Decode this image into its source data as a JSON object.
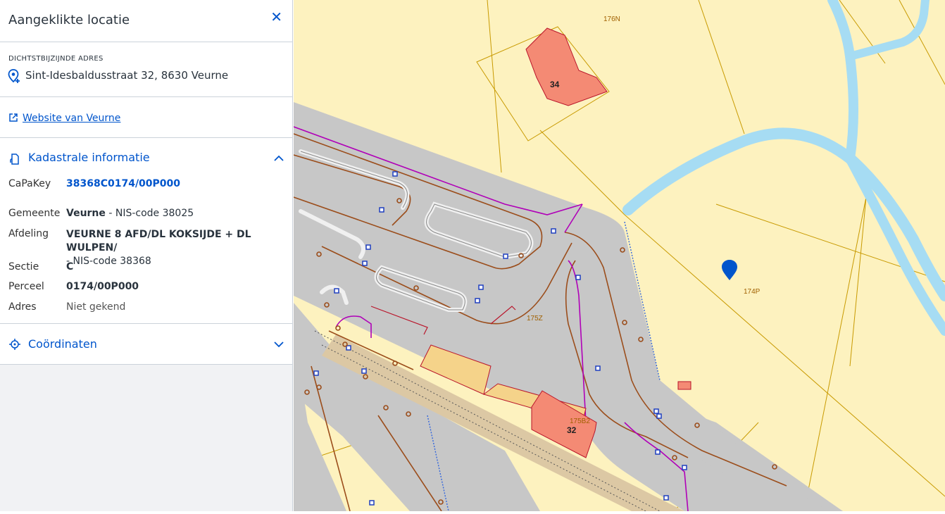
{
  "panel": {
    "title": "Aangeklikte locatie",
    "address_caption": "DICHTSTBIJZIJNDE ADRES",
    "address": "Sint-Idesbaldusstraat 32, 8630 Veurne",
    "website_link": "Website van Veurne",
    "kadaster": {
      "title": "Kadastrale informatie",
      "rows": {
        "capakey_label": "CaPaKey",
        "capakey_value": "38368C0174/00P000",
        "gemeente_label": "Gemeente",
        "gemeente_name": "Veurne",
        "gemeente_suffix": " - NIS-code 38025",
        "afdeling_label": "Afdeling",
        "afdeling_name": "VEURNE 8 AFD/DL KOKSIJDE + DL WULPEN/",
        "afdeling_suffix": " - NIS-code 38368",
        "sectie_label": "Sectie",
        "sectie_value": "C",
        "perceel_label": "Perceel",
        "perceel_value": "0174/00P000",
        "adres_label": "Adres",
        "adres_value": "Niet gekend"
      }
    },
    "coordinates_title": "Coördinaten"
  },
  "map": {
    "parcel_labels": [
      "176N",
      "174P",
      "175Z",
      "175B2"
    ],
    "building_numbers": [
      "34",
      "32"
    ],
    "colors": {
      "parcel_bg": "#fdf2bf",
      "parcel_border": "#c89a00",
      "building": "#f48a74",
      "road": "#c7c7c7",
      "water": "#a6dcf3",
      "accent": "#0055cc"
    }
  }
}
